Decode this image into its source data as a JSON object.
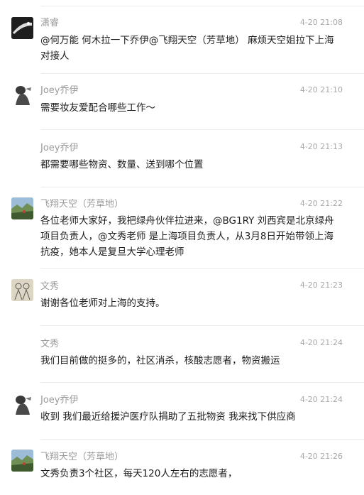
{
  "messages": [
    {
      "name": "潇睿",
      "time": "4-20 21:08",
      "text": "@何万能 何木拉一下乔伊@飞翔天空（芳草地） 麻烦天空姐拉下上海对接人",
      "avatar": "avatar-dark-photo"
    },
    {
      "name": "Joey乔伊",
      "time": "4-20 21:10",
      "text": "需要妆友爱配合哪些工作～",
      "avatar": "avatar-sketch-person"
    },
    {
      "name": "Joey乔伊",
      "time": "4-20 21:13",
      "text": "都需要哪些物资、数量、送到哪个位置",
      "avatar": ""
    },
    {
      "name": "飞翔天空（芳草地）",
      "time": "4-20 21:22",
      "text": "各位老师大家好，我把绿舟伙伴拉进来，@BG1RY 刘西宾是北京绿舟项目负责人，@文秀老师 是上海项目负责人，从3月8日开始带领上海抗疫，她本人是复旦大学心理老师",
      "avatar": "avatar-landscape-photo"
    },
    {
      "name": "文秀",
      "time": "4-20 21:23",
      "text": "谢谢各位老师对上海的支持。",
      "avatar": "avatar-drawing"
    },
    {
      "name": "文秀",
      "time": "4-20 21:24",
      "text": "我们目前做的挺多的，社区消杀，核酸志愿者，物资搬运",
      "avatar": ""
    },
    {
      "name": "Joey乔伊",
      "time": "4-20 21:24",
      "text": "收到 我们最近给援沪医疗队捐助了五批物资 我来找下供应商",
      "avatar": "avatar-sketch-person"
    },
    {
      "name": "飞翔天空（芳草地）",
      "time": "4-20 21:26",
      "text": "文秀负责3个社区，每天120人左右的志愿者，",
      "avatar": "avatar-landscape-photo"
    }
  ]
}
